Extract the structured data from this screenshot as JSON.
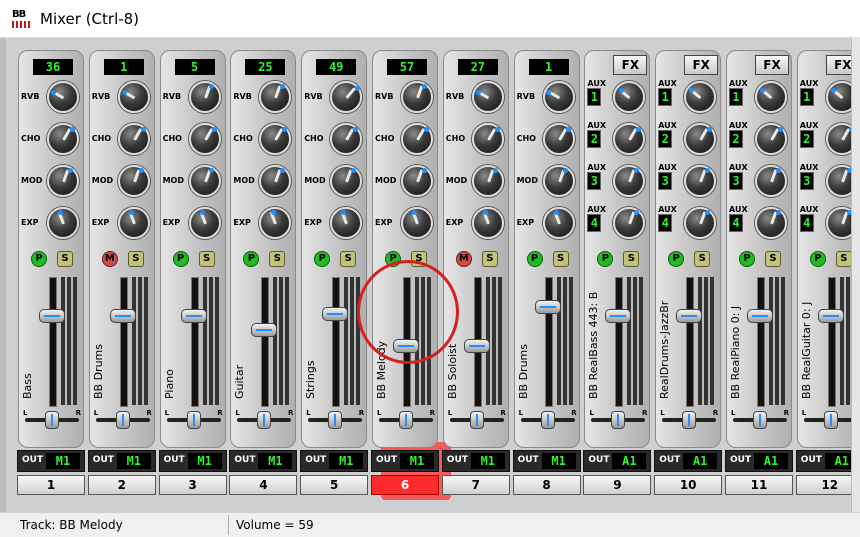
{
  "window": {
    "title": "Mixer (Ctrl-8)",
    "icon": "bb-app-icon"
  },
  "colors": {
    "display_text": "#2ef22e",
    "selected_channel": "#ff2a2a",
    "mute": "#d24b4b",
    "play": "#22bb22",
    "solo": "#c2c27a",
    "pointer_dot": "#1e90ff"
  },
  "labels": {
    "rvb": "RVB",
    "cho": "CHO",
    "mod": "MOD",
    "exp": "EXP",
    "aux": "AUX",
    "fx": "FX",
    "out": "OUT",
    "pan_l": "L",
    "pan_r": "R",
    "play": "P",
    "mute": "M",
    "solo": "S"
  },
  "channels": [
    {
      "top": "36",
      "name": "Bass",
      "out": "M1",
      "num": "1",
      "state": "P",
      "fader": 0.72
    },
    {
      "top": "1",
      "name": "BB Drums",
      "out": "M1",
      "num": "2",
      "state": "M",
      "fader": 0.72
    },
    {
      "top": "5",
      "name": "Piano",
      "out": "M1",
      "num": "3",
      "state": "P",
      "fader": 0.72
    },
    {
      "top": "25",
      "name": "Guitar",
      "out": "M1",
      "num": "4",
      "state": "P",
      "fader": 0.6
    },
    {
      "top": "49",
      "name": "Strings",
      "out": "M1",
      "num": "5",
      "state": "P",
      "fader": 0.74
    },
    {
      "top": "57",
      "name": "BB Melody",
      "out": "M1",
      "num": "6",
      "state": "P",
      "fader": 0.46,
      "selected": true
    },
    {
      "top": "27",
      "name": "BB Soloist",
      "out": "M1",
      "num": "7",
      "state": "M",
      "fader": 0.46
    },
    {
      "top": "1",
      "name": "BB Drums",
      "out": "M1",
      "num": "8",
      "state": "P",
      "fader": 0.8
    },
    {
      "fx": true,
      "name": "BB RealBass 443: B",
      "out": "A1",
      "num": "9",
      "state": "P",
      "fader": 0.72
    },
    {
      "fx": true,
      "name": "RealDrums-JazzBr",
      "out": "A1",
      "num": "10",
      "state": "P",
      "fader": 0.72
    },
    {
      "fx": true,
      "name": "BB RealPiano 0: J",
      "out": "A1",
      "num": "11",
      "state": "P",
      "fader": 0.72
    },
    {
      "fx": true,
      "name": "BB RealGuitar 0: J",
      "out": "A1",
      "num": "12",
      "state": "P",
      "fader": 0.72
    }
  ],
  "aux_numbers": [
    "1",
    "2",
    "3",
    "4"
  ],
  "status": {
    "track": "Track: BB Melody",
    "volume": "Volume = 59"
  }
}
